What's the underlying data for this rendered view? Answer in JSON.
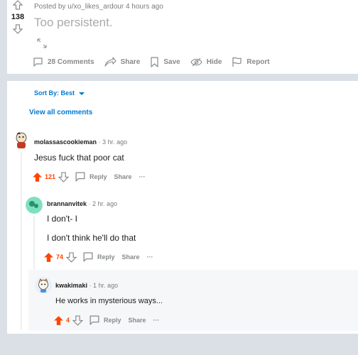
{
  "post": {
    "score": "138",
    "meta": "Posted by u/xo_likes_ardour 4 hours ago",
    "title": "Too persistent.",
    "actions": {
      "comments": "28 Comments",
      "share": "Share",
      "save": "Save",
      "hide": "Hide",
      "report": "Report"
    }
  },
  "comments_section": {
    "sort_label": "Sort By: Best",
    "view_all": "View all comments",
    "comments": [
      {
        "user": "molassascookieman",
        "time": "· 3 hr. ago",
        "body": "Jesus fuck that poor cat",
        "votes": "121",
        "reply": "Reply",
        "share": "Share",
        "more": "···"
      },
      {
        "user": "brannanvitek",
        "time": "· 2 hr. ago",
        "body_lines": [
          "I don't- I",
          "I don't think he'll do that"
        ],
        "votes": "74",
        "reply": "Reply",
        "share": "Share",
        "more": "···"
      },
      {
        "user": "kwakimaki",
        "time": "· 1 hr. ago",
        "body": "He works in mysterious ways...",
        "votes": "4",
        "reply": "Reply",
        "share": "Share",
        "more": "···"
      }
    ]
  },
  "colors": {
    "upvote": "#ff4500",
    "link": "#0079d3",
    "muted": "#878a8c"
  }
}
